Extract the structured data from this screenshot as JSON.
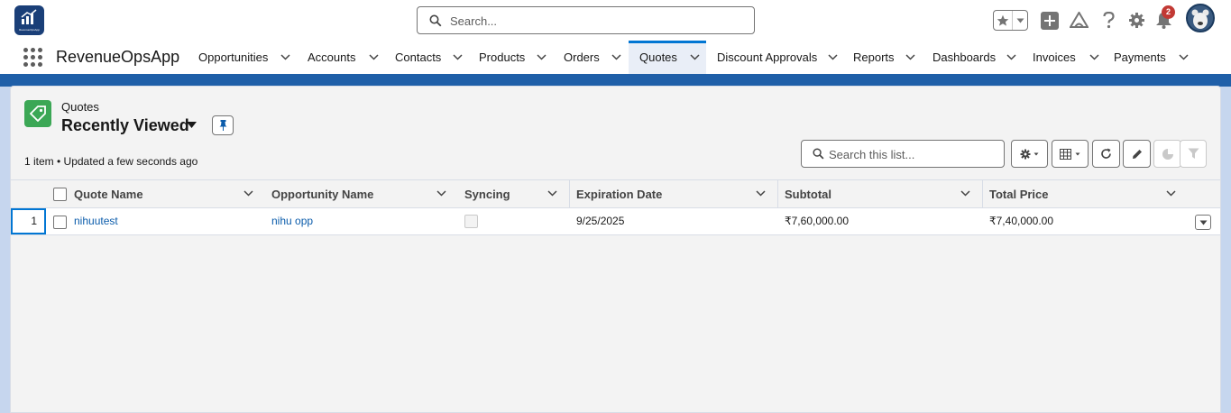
{
  "header": {
    "logo_text": "RevenueOpsApp",
    "search_placeholder": "Search...",
    "notification_count": "2"
  },
  "nav": {
    "app_name": "RevenueOpsApp",
    "items": [
      {
        "label": "Opportunities"
      },
      {
        "label": "Accounts"
      },
      {
        "label": "Contacts"
      },
      {
        "label": "Products"
      },
      {
        "label": "Orders"
      },
      {
        "label": "Quotes",
        "active": true
      },
      {
        "label": "Discount Approvals"
      },
      {
        "label": "Reports"
      },
      {
        "label": "Dashboards"
      },
      {
        "label": "Invoices"
      },
      {
        "label": "Payments"
      }
    ]
  },
  "list_view": {
    "object_label": "Quotes",
    "view_name": "Recently Viewed",
    "meta": "1 item • Updated a few seconds ago",
    "search_placeholder": "Search this list...",
    "columns": [
      "Quote Name",
      "Opportunity Name",
      "Syncing",
      "Expiration Date",
      "Subtotal",
      "Total Price"
    ],
    "rows": [
      {
        "num": "1",
        "quote_name": "nihuutest",
        "opportunity_name": "nihu opp",
        "syncing": false,
        "expiration_date": "9/25/2025",
        "subtotal": "₹7,60,000.00",
        "total_price": "₹7,40,000.00"
      }
    ]
  },
  "colors": {
    "brand_blue": "#0176d3",
    "link": "#0b5cab",
    "quote_icon_green": "#3ba755",
    "notification_red": "#c23934",
    "app_logo_navy": "#1a3f78"
  }
}
